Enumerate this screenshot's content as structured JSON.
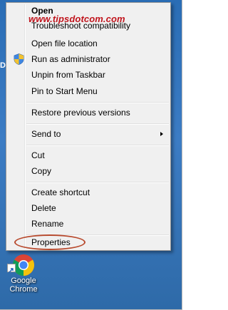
{
  "watermark": "www.tipsdotcom.com",
  "desktop_letter": "D",
  "menu": {
    "open": "Open",
    "troubleshoot": "Troubleshoot compatibility",
    "open_file_location": "Open file location",
    "run_as_admin": "Run as administrator",
    "unpin_taskbar": "Unpin from Taskbar",
    "pin_start": "Pin to Start Menu",
    "restore_versions": "Restore previous versions",
    "send_to": "Send to",
    "cut": "Cut",
    "copy": "Copy",
    "create_shortcut": "Create shortcut",
    "delete": "Delete",
    "rename": "Rename",
    "properties": "Properties"
  },
  "shortcut": {
    "label_line1": "Google",
    "label_line2": "Chrome"
  },
  "colors": {
    "highlight_ellipse": "#b84a2e",
    "watermark": "#c0141c",
    "desktop": "#3c7cc4"
  }
}
